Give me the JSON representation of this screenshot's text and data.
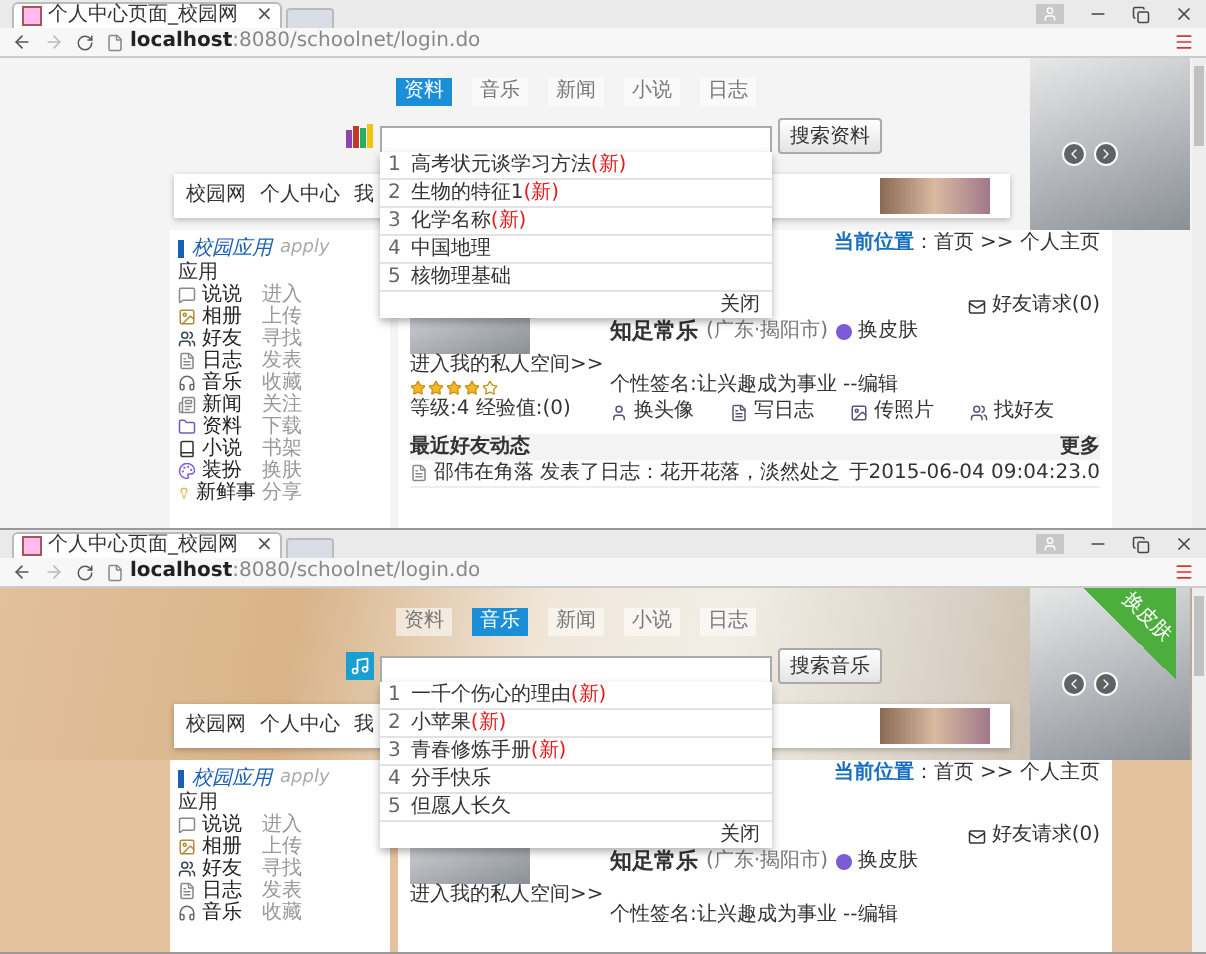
{
  "windows": [
    {
      "skinned": false,
      "tab": {
        "title": "个人中心页面_校园网",
        "close": "×"
      },
      "address": "**localhost**:8080/schoolnet/login.do",
      "search": {
        "tabs": [
          {
            "label": "资料",
            "selected": true
          },
          {
            "label": "音乐",
            "selected": false
          },
          {
            "label": "新闻",
            "selected": false
          },
          {
            "label": "小说",
            "selected": false
          },
          {
            "label": "日志",
            "selected": false
          }
        ],
        "button": "搜索资料",
        "suggestions": [
          {
            "number": "1",
            "text": "高考状元谈学习方法",
            "badge": "(新)"
          },
          {
            "number": "2",
            "text": "生物的特征1",
            "badge": "(新)"
          },
          {
            "number": "3",
            "text": "化学名称",
            "badge": "(新)"
          },
          {
            "number": "4",
            "text": "中国地理"
          },
          {
            "number": "5",
            "text": "核物理基础"
          }
        ],
        "close": "关闭"
      },
      "nav": [
        "校园网",
        "个人中心",
        "我"
      ],
      "sidebar": {
        "title": "校园应用",
        "subtitle": "apply",
        "heading": "应用",
        "items": [
          {
            "name": "说说",
            "action": "进入"
          },
          {
            "name": "相册",
            "action": "上传"
          },
          {
            "name": "好友",
            "action": "寻找"
          },
          {
            "name": "日志",
            "action": "发表"
          },
          {
            "name": "音乐",
            "action": "收藏"
          },
          {
            "name": "新闻",
            "action": "关注"
          },
          {
            "name": "资料",
            "action": "下载"
          },
          {
            "name": "小说",
            "action": "书架"
          },
          {
            "name": "装扮",
            "action": "换肤"
          },
          {
            "name": "新鲜事",
            "action": "分享"
          }
        ]
      },
      "main": {
        "breadcrumb": "**当前位置**：首页 >> 个人主页",
        "friend_requests": "好友请求(0)",
        "user": {
          "name": "知足常乐",
          "location": "(广东·揭阳市)",
          "skin_link": "换皮肤"
        },
        "space_link": "进入我的私人空间>>",
        "stars": 4,
        "level": "等级:4 经验值:(0)",
        "signature": "个性签名:让兴趣成为事业 --编辑",
        "actions": [
          "换头像",
          "写日志",
          "传照片",
          "找好友"
        ],
        "feed": {
          "title": "最近好友动态",
          "more": "更多",
          "rows": [
            {
              "text": "邵伟在角落 发表了日志：花开花落，淡然处之",
              "time": "于2015-06-04 09:04:23.0"
            }
          ]
        }
      }
    },
    {
      "skinned": true,
      "ribbon": "换皮肤",
      "tab": {
        "title": "个人中心页面_校园网",
        "close": "×"
      },
      "address": "**localhost**:8080/schoolnet/login.do",
      "search": {
        "tabs": [
          {
            "label": "资料",
            "selected": false
          },
          {
            "label": "音乐",
            "selected": true
          },
          {
            "label": "新闻",
            "selected": false
          },
          {
            "label": "小说",
            "selected": false
          },
          {
            "label": "日志",
            "selected": false
          }
        ],
        "button": "搜索音乐",
        "suggestions": [
          {
            "number": "1",
            "text": "一千个伤心的理由",
            "badge": "(新)"
          },
          {
            "number": "2",
            "text": "小苹果",
            "badge": "(新)"
          },
          {
            "number": "3",
            "text": "青春修炼手册",
            "badge": "(新)"
          },
          {
            "number": "4",
            "text": "分手快乐"
          },
          {
            "number": "5",
            "text": "但愿人长久"
          }
        ],
        "close": "关闭"
      },
      "nav": [
        "校园网",
        "个人中心",
        "我"
      ],
      "sidebar": {
        "title": "校园应用",
        "subtitle": "apply",
        "heading": "应用",
        "items": [
          {
            "name": "说说",
            "action": "进入"
          },
          {
            "name": "相册",
            "action": "上传"
          },
          {
            "name": "好友",
            "action": "寻找"
          },
          {
            "name": "日志",
            "action": "发表"
          },
          {
            "name": "音乐",
            "action": "收藏"
          }
        ]
      },
      "main": {
        "breadcrumb": "**当前位置**：首页 >> 个人主页",
        "friend_requests": "好友请求(0)",
        "user": {
          "name": "知足常乐",
          "location": "(广东·揭阳市)",
          "skin_link": "换皮肤"
        },
        "space_link": "进入我的私人空间>>",
        "signature": "个性签名:让兴趣成为事业 --编辑"
      }
    }
  ]
}
